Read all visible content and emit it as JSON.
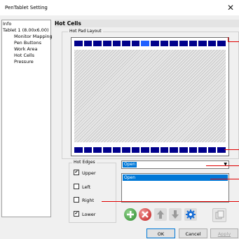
{
  "window": {
    "title": "PenTablet Setting",
    "close_glyph": "✕"
  },
  "tree": {
    "items": [
      {
        "label": "Info"
      },
      {
        "label": "Tablet  1 (8.00x6.00)"
      },
      {
        "label": "Monitor Mapping"
      },
      {
        "label": "Pen Buttons"
      },
      {
        "label": "Work Area"
      },
      {
        "label": "Hot Cells"
      },
      {
        "label": "Pressure"
      }
    ]
  },
  "section": {
    "title": "Hot Cells"
  },
  "hot_pad_layout": {
    "label": "Hot Pad Layout",
    "top_cells": 16,
    "bottom_cells": 16,
    "selected_top_index": 7,
    "cell_color": "#00008b",
    "selected_color": "#1f5fff"
  },
  "hot_edges": {
    "label": "Hot Edges",
    "items": [
      {
        "label": "Upper",
        "checked": true
      },
      {
        "label": "Left",
        "checked": false
      },
      {
        "label": "Right",
        "checked": false
      },
      {
        "label": "Lower",
        "checked": true
      }
    ]
  },
  "action_select": {
    "value": "Open",
    "arrow_glyph": "▼"
  },
  "action_list": {
    "items": [
      "Open"
    ]
  },
  "toolbar": {
    "add_icon": "plus-circle-icon",
    "delete_icon": "x-circle-icon",
    "up_icon": "arrow-up-icon",
    "down_icon": "arrow-down-icon",
    "settings_icon": "gear-icon",
    "copy_icon": "copy-icon"
  },
  "buttons": {
    "ok": "OK",
    "cancel": "Cancel",
    "apply": "Apply"
  },
  "accent_colors": {
    "marker": "#e00000",
    "selection": "#0078d7"
  }
}
